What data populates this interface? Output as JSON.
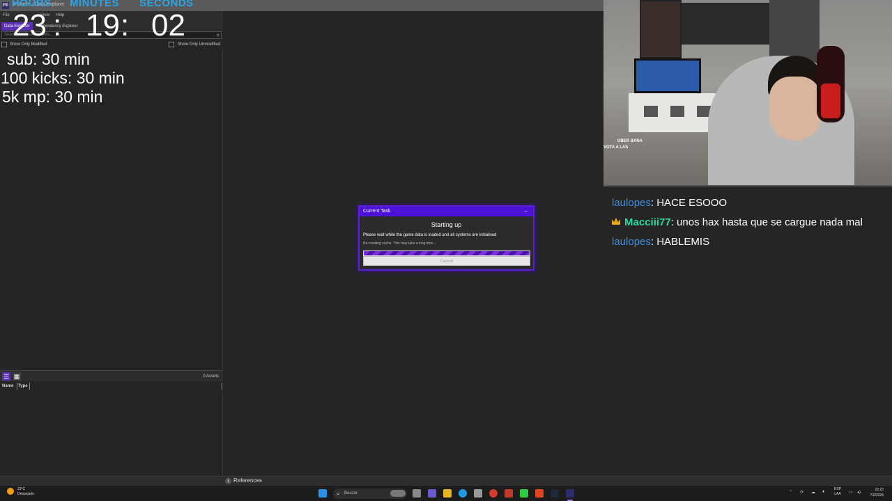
{
  "window": {
    "logo": "FE",
    "title": "FModel - Data Explorer"
  },
  "menu": {
    "file": "File",
    "view": "View",
    "help": "Help"
  },
  "tabs": {
    "data_explorer": "Data Explorer",
    "dependency_explorer": "Dependency Explorer"
  },
  "search": {
    "placeholder": "Search for Assets / Files..."
  },
  "filters": {
    "modified": "Show Only Modified",
    "unmodified": "Show Only Unmodified"
  },
  "timer": {
    "labels": {
      "hours": "HOURS",
      "minutes": "MINUTES",
      "seconds": "SECONDS"
    },
    "hours": "23",
    "sep1": ":",
    "minutes": "19",
    "sep2": ":",
    "seconds": "02"
  },
  "goals": [
    "sub: 30 min",
    "100 kicks: 30 min",
    "5k mp: 30 min"
  ],
  "assets": {
    "count": "0 Assets",
    "columns": {
      "name": "Name",
      "type": "Type"
    },
    "list_icon": "list-icon",
    "grid_icon": "grid-icon"
  },
  "references": {
    "label": "References",
    "icon": "info-icon"
  },
  "dialog": {
    "title": "Current Task",
    "close": "–",
    "heading": "Starting up",
    "message": "Please wait while the game data is loaded and all systems are initialised",
    "status": "Re-creating cache. This may take a long time...",
    "progress": 1.0,
    "cancel": "Cancel"
  },
  "webcam": {
    "overlay_line1": "UBER BANA",
    "overlay_line2": "VOTA A LAS"
  },
  "chat": [
    {
      "user": "laulopes",
      "message": ": HACE ESOOO",
      "badge": false
    },
    {
      "user": "Macciii77",
      "message": ": unos hax hasta que se cargue nada mal",
      "badge": true
    },
    {
      "user": "laulopes",
      "message": ": HABLEMIS",
      "badge": false
    }
  ],
  "taskbar": {
    "temp": "23°C",
    "weather": "Despejado",
    "search": "Buscar",
    "lang1": "ESP",
    "lang2": "LAA",
    "time": "22:22",
    "date": "7/2/2026",
    "icons": [
      "windows-icon",
      "search-icon",
      "task-view-icon",
      "chat-icon",
      "explorer-icon",
      "edge-icon",
      "calculator-icon",
      "chrome-icon",
      "media-icon",
      "minecraft-icon",
      "brave-icon",
      "steam-icon",
      "fmodel-icon"
    ]
  },
  "colors": {
    "accent": "#5b2fb3",
    "dialog_border": "#5a1fd6",
    "timer_label": "#29a4e8",
    "chat_user": "#3e8ce0",
    "chat_user_vip": "#2bd99a"
  }
}
